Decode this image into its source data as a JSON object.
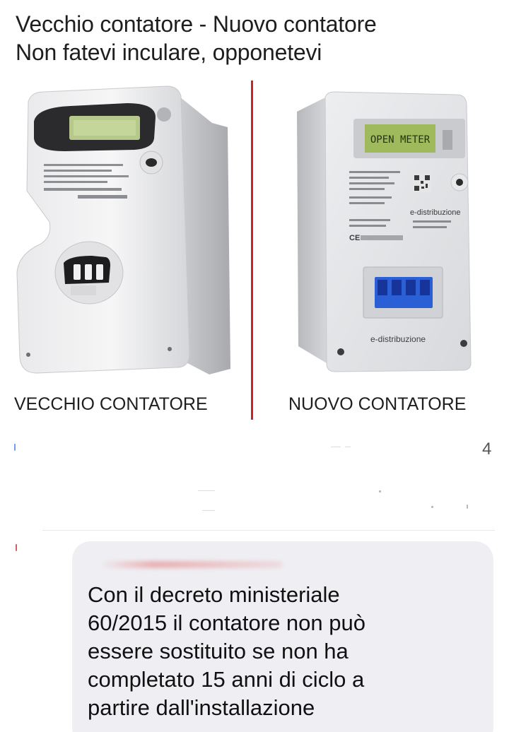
{
  "header": {
    "line1": "Vecchio contatore - Nuovo contatore",
    "line2": "Non fatevi inculare, opponetevi"
  },
  "old_meter": {
    "caption": "VECCHIO CONTATORE"
  },
  "new_meter": {
    "caption": "NUOVO CONTATORE",
    "display_text": "OPEN METER",
    "brand": "e-distribuzione",
    "brand_bottom": "e-distribuzione",
    "ce_mark": "CE"
  },
  "post": {
    "count": "4"
  },
  "comment": {
    "lines": [
      "Con il decreto ministeriale",
      "60/2015 il contatore non può",
      "essere sostituito se non ha",
      "completato 15 anni di ciclo a",
      "partire dall'installazione"
    ]
  },
  "colors": {
    "divider": "#c8242a",
    "lcd": "#a9c46a",
    "breaker": "#2a5fd6",
    "bubble": "#efeff3"
  }
}
